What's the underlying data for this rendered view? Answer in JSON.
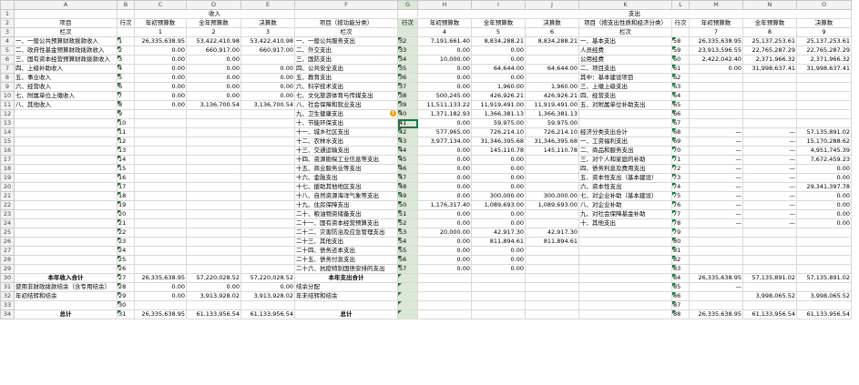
{
  "columns": [
    "A",
    "B",
    "C",
    "D",
    "E",
    "F",
    "G",
    "H",
    "I",
    "J",
    "K",
    "L",
    "M",
    "N",
    "O"
  ],
  "header": {
    "income": "收入",
    "expense": "支出",
    "item": "项目",
    "line": "行次",
    "budget_initial": "年初预算数",
    "budget_full": "全年预算数",
    "final": "决算数",
    "item_func": "项目（按功能分类）",
    "item_econ": "项目（按支出性质和经济分类）",
    "lan_ci": "栏次",
    "nums": {
      "c": "1",
      "d": "2",
      "e": "3",
      "h": "4",
      "i": "5",
      "j": "6",
      "m": "7",
      "n": "8",
      "o": "9"
    }
  },
  "rows": [
    {
      "rn": "4",
      "a": "一、一般公共预算财政拨款收入",
      "b": "1",
      "c": "26,335,638.95",
      "d": "53,422,410.98",
      "e": "53,422,410.98",
      "f": "一、一般公共服务支出",
      "g": "32",
      "h": "7,191,661.40",
      "i": "8,834,288.21",
      "j": "8,834,288.21",
      "k": "一、基本支出",
      "l": "58",
      "m": "26,335,638.95",
      "n": "25,137,253.61",
      "o": "25,137,253.61"
    },
    {
      "rn": "5",
      "a": "二、政府性基金预算财政拨款收入",
      "b": "2",
      "c": "0.00",
      "d": "660,917.00",
      "e": "660,917.00",
      "f": "二、外交支出",
      "g": "33",
      "h": "0.00",
      "i": "0.00",
      "j": "",
      "k": "人员经费",
      "l": "59",
      "m": "23,913,596.55",
      "n": "22,765,287.29",
      "o": "22,765,287.29"
    },
    {
      "rn": "6",
      "a": "三、国有资本经营预算财政拨款收入",
      "b": "3",
      "c": "0.00",
      "d": "0.00",
      "e": "",
      "f": "三、国防支出",
      "g": "34",
      "h": "10,000.00",
      "i": "0.00",
      "j": "",
      "k": "公用经费",
      "l": "60",
      "m": "2,422,042.40",
      "n": "2,371,966.32",
      "o": "2,371,966.32"
    },
    {
      "rn": "7",
      "a": "四、上级补助收入",
      "b": "4",
      "c": "0.00",
      "d": "0.00",
      "e": "0.00",
      "f": "四、公共安全支出",
      "g": "35",
      "h": "0.00",
      "i": "64,644.00",
      "j": "64,644.00",
      "k": "二、项目支出",
      "l": "61",
      "m": "0.00",
      "n": "31,998,637.41",
      "o": "31,998,637.41"
    },
    {
      "rn": "8",
      "a": "五、事业收入",
      "b": "5",
      "c": "0.00",
      "d": "0.00",
      "e": "0.00",
      "f": "五、教育支出",
      "g": "36",
      "h": "0.00",
      "i": "0.00",
      "j": "",
      "k": "其中：基本建设项目",
      "l": "62",
      "m": "",
      "n": "",
      "o": ""
    },
    {
      "rn": "9",
      "a": "六、经营收入",
      "b": "6",
      "c": "0.00",
      "d": "0.00",
      "e": "0.00",
      "f": "六、科学技术支出",
      "g": "37",
      "h": "0.00",
      "i": "1,960.00",
      "j": "1,960.00",
      "k": "三、上缴上级支出",
      "l": "63",
      "m": "",
      "n": "",
      "o": ""
    },
    {
      "rn": "10",
      "a": "七、附属单位上缴收入",
      "b": "7",
      "c": "0.00",
      "d": "0.00",
      "e": "0.00",
      "f": "七、文化旅游体育与传媒支出",
      "g": "38",
      "h": "500,245.00",
      "i": "426,926.21",
      "j": "426,926.21",
      "k": "四、经营支出",
      "l": "64",
      "m": "",
      "n": "",
      "o": ""
    },
    {
      "rn": "11",
      "a": "八、其他收入",
      "b": "8",
      "c": "0.00",
      "d": "3,136,700.54",
      "e": "3,136,700.54",
      "f": "八、社会保障和就业支出",
      "g": "39",
      "h": "11,511,133.22",
      "i": "11,919,491.00",
      "j": "11,919,491.00",
      "k": "五、对附属单位补助支出",
      "l": "65",
      "m": "",
      "n": "",
      "o": ""
    },
    {
      "rn": "12",
      "a": "",
      "b": "9",
      "c": "",
      "d": "",
      "e": "",
      "f": "九、卫生健康支出",
      "g": "40",
      "h": "1,371,182.93",
      "i": "1,366,381.13",
      "j": "1,366,381.13",
      "k": "",
      "l": "66",
      "m": "",
      "n": "",
      "o": ""
    },
    {
      "rn": "13",
      "a": "",
      "b": "10",
      "c": "",
      "d": "",
      "e": "",
      "f": "十、节能环保支出",
      "g": "41",
      "h": "0.00",
      "i": "59,975.00",
      "j": "59,975.00",
      "k": "",
      "l": "67",
      "m": "",
      "n": "",
      "o": ""
    },
    {
      "rn": "14",
      "a": "",
      "b": "11",
      "c": "",
      "d": "",
      "e": "",
      "f": "十一、城乡社区支出",
      "g": "42",
      "h": "577,965.00",
      "i": "726,214.10",
      "j": "726,214.10",
      "k": "经济分类支出合计",
      "l": "68",
      "m": "—",
      "n": "—",
      "o": "57,135,891.02"
    },
    {
      "rn": "15",
      "a": "",
      "b": "12",
      "c": "",
      "d": "",
      "e": "",
      "f": "十二、农林水支出",
      "g": "43",
      "h": "3,977,134.00",
      "i": "31,346,395.68",
      "j": "31,346,395.68",
      "k": "一、工资福利支出",
      "l": "69",
      "m": "—",
      "n": "—",
      "o": "15,170,288.62"
    },
    {
      "rn": "16",
      "a": "",
      "b": "13",
      "c": "",
      "d": "",
      "e": "",
      "f": "十三、交通运输支出",
      "g": "44",
      "h": "0.00",
      "i": "145,110.78",
      "j": "145,110.78",
      "k": "二、商品和服务支出",
      "l": "70",
      "m": "—",
      "n": "—",
      "o": "4,951,745.39"
    },
    {
      "rn": "17",
      "a": "",
      "b": "14",
      "c": "",
      "d": "",
      "e": "",
      "f": "十四、资源勘探工业信息等支出",
      "g": "45",
      "h": "0.00",
      "i": "0.00",
      "j": "",
      "k": "三、对个人和家庭的补助",
      "l": "71",
      "m": "—",
      "n": "—",
      "o": "7,672,459.23"
    },
    {
      "rn": "18",
      "a": "",
      "b": "15",
      "c": "",
      "d": "",
      "e": "",
      "f": "十五、商业服务业等支出",
      "g": "46",
      "h": "0.00",
      "i": "0.00",
      "j": "",
      "k": "四、债务利息及费用支出",
      "l": "72",
      "m": "—",
      "n": "—",
      "o": "0.00"
    },
    {
      "rn": "19",
      "a": "",
      "b": "16",
      "c": "",
      "d": "",
      "e": "",
      "f": "十六、金融支出",
      "g": "47",
      "h": "0.00",
      "i": "0.00",
      "j": "",
      "k": "五、资本性支出（基本建设）",
      "l": "73",
      "m": "—",
      "n": "—",
      "o": "0.00"
    },
    {
      "rn": "20",
      "a": "",
      "b": "17",
      "c": "",
      "d": "",
      "e": "",
      "f": "十七、援助其他地区支出",
      "g": "48",
      "h": "0.00",
      "i": "0.00",
      "j": "",
      "k": "六、资本性支出",
      "l": "74",
      "m": "—",
      "n": "—",
      "o": "29,341,397.78"
    },
    {
      "rn": "21",
      "a": "",
      "b": "18",
      "c": "",
      "d": "",
      "e": "",
      "f": "十八、自然资源海洋气象等支出",
      "g": "49",
      "h": "0.00",
      "i": "300,000.00",
      "j": "300,000.00",
      "k": "七、对企业补助（基本建设）",
      "l": "75",
      "m": "—",
      "n": "—",
      "o": "0.00"
    },
    {
      "rn": "22",
      "a": "",
      "b": "19",
      "c": "",
      "d": "",
      "e": "",
      "f": "十九、住房保障支出",
      "g": "50",
      "h": "1,176,317.40",
      "i": "1,089,693.00",
      "j": "1,089,693.00",
      "k": "八、对企业补助",
      "l": "76",
      "m": "—",
      "n": "—",
      "o": "0.00"
    },
    {
      "rn": "23",
      "a": "",
      "b": "20",
      "c": "",
      "d": "",
      "e": "",
      "f": "二十、粮油物资储备支出",
      "g": "51",
      "h": "0.00",
      "i": "0.00",
      "j": "",
      "k": "九、对社会保障基金补助",
      "l": "77",
      "m": "—",
      "n": "—",
      "o": "0.00"
    },
    {
      "rn": "24",
      "a": "",
      "b": "21",
      "c": "",
      "d": "",
      "e": "",
      "f": "二十一、国有资本经营预算支出",
      "g": "52",
      "h": "0.00",
      "i": "0.00",
      "j": "",
      "k": "十、其他支出",
      "l": "78",
      "m": "—",
      "n": "—",
      "o": "0.00"
    },
    {
      "rn": "25",
      "a": "",
      "b": "22",
      "c": "",
      "d": "",
      "e": "",
      "f": "二十二、灾害防治及应急管理支出",
      "g": "53",
      "h": "20,000.00",
      "i": "42,917.30",
      "j": "42,917.30",
      "k": "",
      "l": "79",
      "m": "",
      "n": "",
      "o": ""
    },
    {
      "rn": "26",
      "a": "",
      "b": "23",
      "c": "",
      "d": "",
      "e": "",
      "f": "二十三、其他支出",
      "g": "54",
      "h": "0.00",
      "i": "811,894.61",
      "j": "811,894.61",
      "k": "",
      "l": "80",
      "m": "",
      "n": "",
      "o": ""
    },
    {
      "rn": "27",
      "a": "",
      "b": "24",
      "c": "",
      "d": "",
      "e": "",
      "f": "二十四、债务还本支出",
      "g": "55",
      "h": "0.00",
      "i": "0.00",
      "j": "",
      "k": "",
      "l": "81",
      "m": "",
      "n": "",
      "o": ""
    },
    {
      "rn": "28",
      "a": "",
      "b": "25",
      "c": "",
      "d": "",
      "e": "",
      "f": "二十五、债务付息支出",
      "g": "56",
      "h": "0.00",
      "i": "0.00",
      "j": "",
      "k": "",
      "l": "82",
      "m": "",
      "n": "",
      "o": ""
    },
    {
      "rn": "29",
      "a": "",
      "b": "26",
      "c": "",
      "d": "",
      "e": "",
      "f": "二十六、抗疫特别国债安排的支出",
      "g": "57",
      "h": "0.00",
      "i": "0.00",
      "j": "",
      "k": "",
      "l": "83",
      "m": "",
      "n": "",
      "o": ""
    },
    {
      "rn": "30",
      "a": "本年收入合计",
      "b": "27",
      "c": "26,335,638.95",
      "d": "57,220,028.52",
      "e": "57,220,028.52",
      "f": "本年支出合计",
      "g": "",
      "h": "",
      "i": "",
      "j": "",
      "k": "",
      "l": "84",
      "m": "26,335,638.95",
      "n": "57,135,891.02",
      "o": "57,135,891.02",
      "bold": true
    },
    {
      "rn": "31",
      "a": "使用非财政拨款结余（含专用结余）",
      "b": "28",
      "c": "0.00",
      "d": "0.00",
      "e": "0.00",
      "f": "结余分配",
      "g": "",
      "h": "",
      "i": "",
      "j": "",
      "k": "",
      "l": "85",
      "m": "—",
      "n": "",
      "o": ""
    },
    {
      "rn": "32",
      "a": "年初结转和结余",
      "b": "29",
      "c": "0.00",
      "d": "3,913,928.02",
      "e": "3,913,928.02",
      "f": "年末结转和结余",
      "g": "",
      "h": "",
      "i": "",
      "j": "",
      "k": "",
      "l": "86",
      "m": "",
      "n": "3,998,065.52",
      "o": "3,998,065.52"
    },
    {
      "rn": "33",
      "a": "",
      "b": "30",
      "c": "",
      "d": "",
      "e": "",
      "f": "",
      "g": "",
      "h": "",
      "i": "",
      "j": "",
      "k": "",
      "l": "87",
      "m": "",
      "n": "",
      "o": ""
    },
    {
      "rn": "34",
      "a": "总计",
      "b": "31",
      "c": "26,335,638.95",
      "d": "61,133,956.54",
      "e": "61,133,956.54",
      "f": "总计",
      "g": "",
      "h": "",
      "i": "",
      "j": "",
      "k": "",
      "l": "88",
      "m": "26,335,638.95",
      "n": "61,133,956.54",
      "o": "61,133,956.54",
      "bold": true
    }
  ]
}
